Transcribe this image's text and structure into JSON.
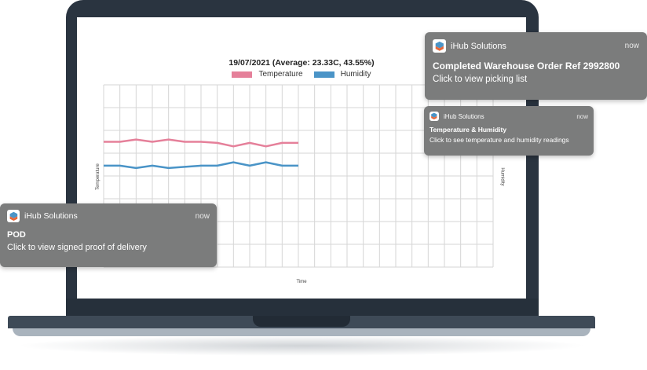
{
  "chart": {
    "title": "19/07/2021 (Average: 23.33C, 43.55%)",
    "y_left_label": "Temperature",
    "y_right_label": "Humidity",
    "x_label": "Time",
    "legend": [
      {
        "label": "Temperature",
        "color": "#e5809a"
      },
      {
        "label": "Humidity",
        "color": "#4a94c7"
      }
    ]
  },
  "chart_data": {
    "type": "line",
    "title": "19/07/2021 (Average: 23.33C, 43.55%)",
    "xlabel": "Time",
    "ylabel": "Temperature",
    "y2label": "Humidity",
    "grid": true,
    "legend_position": "top",
    "series": [
      {
        "name": "Temperature",
        "color": "#e5809a",
        "values": [
          5.5,
          5.5,
          5.6,
          5.5,
          5.6,
          5.5,
          5.5,
          5.45,
          5.3,
          5.45,
          5.3,
          5.45,
          5.45
        ]
      },
      {
        "name": "Humidity",
        "color": "#4a94c7",
        "values": [
          4.45,
          4.45,
          4.35,
          4.45,
          4.35,
          4.4,
          4.45,
          4.45,
          4.6,
          4.45,
          4.6,
          4.45,
          4.45
        ]
      }
    ],
    "ylim": [
      0,
      8
    ]
  },
  "notifications": {
    "warehouse": {
      "app": "iHub Solutions",
      "time": "now",
      "title": "Completed Warehouse Order Ref 2992800",
      "body": "Click to view picking list"
    },
    "temperature": {
      "app": "iHub Solutions",
      "time": "now",
      "title": "Temperature & Humidity",
      "body": "Click to see temperature and humidity readings"
    },
    "pod": {
      "app": "iHub Solutions",
      "time": "now",
      "title": "POD",
      "body": "Click to view signed proof of delivery"
    }
  }
}
